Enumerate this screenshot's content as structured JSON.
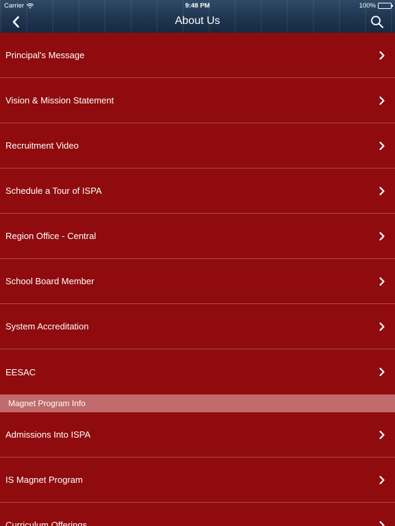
{
  "status_bar": {
    "carrier": "Carrier",
    "time": "9:48 PM",
    "battery": "100%"
  },
  "nav": {
    "title": "About Us",
    "back_icon": "chevron-left-icon",
    "search_icon": "search-icon"
  },
  "colors": {
    "row_bg": "#8f0b0d",
    "section_bg": "#c06a6b",
    "header_bg": "#1f3550",
    "divider": "#b04a4a"
  },
  "items_group1": [
    {
      "label": "Principal's Message"
    },
    {
      "label": "Vision & Mission Statement"
    },
    {
      "label": "Recruitment Video"
    },
    {
      "label": "Schedule a Tour of ISPA"
    },
    {
      "label": "Region Office - Central"
    },
    {
      "label": "School Board Member"
    },
    {
      "label": "System Accreditation"
    },
    {
      "label": "EESAC"
    }
  ],
  "section": {
    "label": "Magnet Program Info"
  },
  "items_group2": [
    {
      "label": "Admissions Into ISPA"
    },
    {
      "label": "IS Magnet Program"
    },
    {
      "label": "Curriculum Offerings"
    }
  ]
}
